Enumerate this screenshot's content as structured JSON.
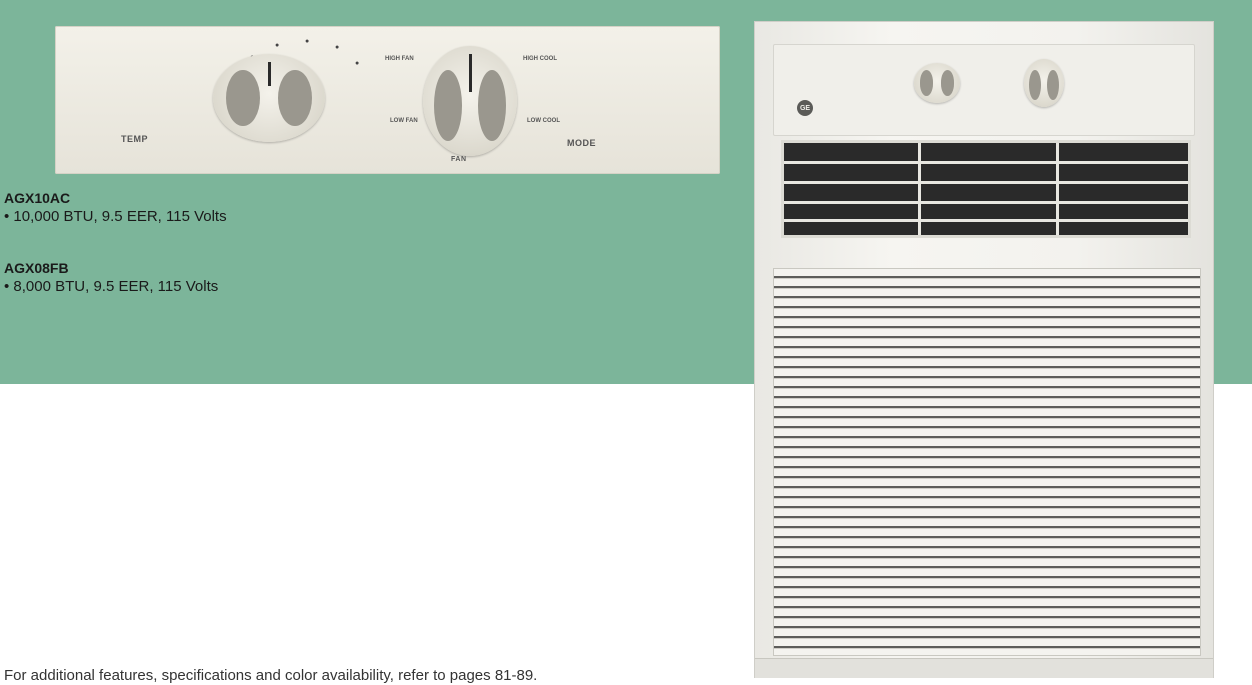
{
  "models": [
    {
      "name": "AGX10AC",
      "spec": "• 10,000 BTU, 9.5 EER, 115 Volts"
    },
    {
      "name": "AGX08FB",
      "spec": "• 8,000 BTU, 9.5 EER, 115 Volts"
    }
  ],
  "panel": {
    "temp_label": "TEMP",
    "mode_label": "MODE",
    "fan_label": "FAN",
    "high_cool": "HIGH COOL",
    "high_fan": "HIGH FAN",
    "low_cool": "LOW COOL",
    "low_fan": "LOW FAN"
  },
  "footnote": "For additional features, specifications and color availability, refer to pages 81-89.",
  "colors": {
    "banner": "#7cb59a",
    "text": "#1a1a1a"
  },
  "images": [
    "control-panel-closeup",
    "window-air-conditioner-unit",
    "ge-logo"
  ]
}
